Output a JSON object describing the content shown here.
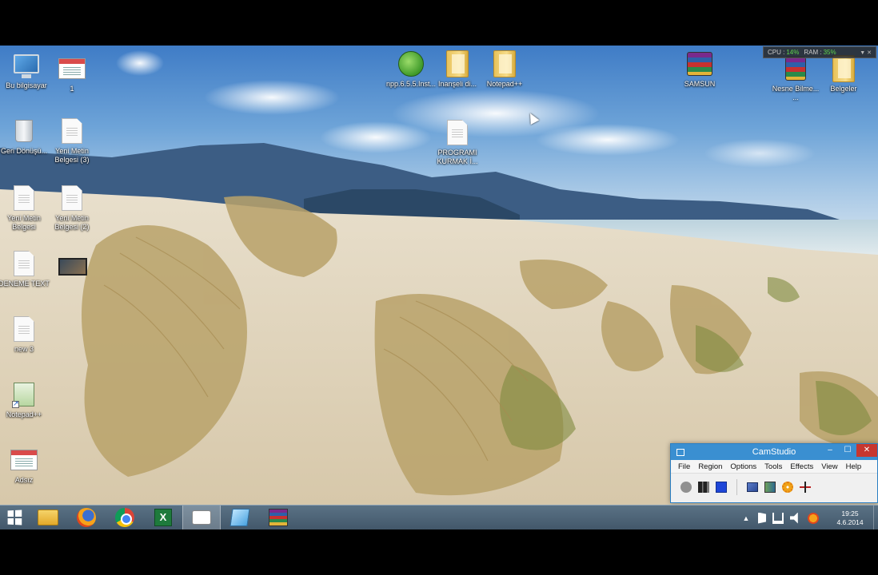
{
  "desktop": {
    "icons": [
      {
        "label": "Bu bilgisayar",
        "icon": "computer-icon"
      },
      {
        "label": "1",
        "icon": "shortcut-icon"
      },
      {
        "label": "Geri Dönüşü...",
        "icon": "recycle-bin-icon"
      },
      {
        "label": "Yeni Metin Belgesi (3)",
        "icon": "text-document-icon"
      },
      {
        "label": "Yeni Metin Belgesi",
        "icon": "text-document-icon"
      },
      {
        "label": "Yeni Metin Belgesi (2)",
        "icon": "text-document-icon"
      },
      {
        "label": "DENEME TEXT",
        "icon": "text-document-icon"
      },
      {
        "label": "",
        "icon": "video-thumbnail-icon"
      },
      {
        "label": "new 3",
        "icon": "text-document-icon"
      },
      {
        "label": "Notepad++",
        "icon": "notepad-plus-plus-icon"
      },
      {
        "label": "Adsız",
        "icon": "shortcut-icon"
      },
      {
        "label": "npp.6.5.5.Inst...",
        "icon": "notepad-plus-plus-icon"
      },
      {
        "label": "Inanşeli di...",
        "icon": "folder-icon"
      },
      {
        "label": "Notepad++",
        "icon": "folder-icon"
      },
      {
        "label": "PROGRAMI KURMAK İ...",
        "icon": "text-document-icon"
      },
      {
        "label": "SAMSUN",
        "icon": "winrar-archive-icon"
      },
      {
        "label": "Nesne Bilme... ...",
        "icon": "winrar-archive-icon"
      },
      {
        "label": "Belgeler",
        "icon": "folder-icon"
      }
    ],
    "perf_monitor": {
      "cpu_label": "CPU :",
      "cpu_value": "14%",
      "ram_label": "RAM :",
      "ram_value": "35%"
    }
  },
  "camstudio": {
    "title": "CamStudio",
    "menu": [
      "File",
      "Region",
      "Options",
      "Tools",
      "Effects",
      "View",
      "Help"
    ],
    "toolbar": [
      "record-icon",
      "pause-icon",
      "stop-icon",
      "screen-icon",
      "film-icon",
      "settings-gear-icon",
      "cut-icon"
    ],
    "window_buttons": {
      "minimize": "–",
      "maximize": "☐",
      "close": "✕"
    }
  },
  "taskbar": {
    "pinned": [
      "windows-start-icon",
      "file-explorer-icon",
      "firefox-icon",
      "chrome-icon",
      "excel-icon",
      "camstudio-icon",
      "glass-app-icon",
      "winrar-icon"
    ],
    "clock": {
      "time": "19:25",
      "date": "4.6.2014"
    }
  }
}
